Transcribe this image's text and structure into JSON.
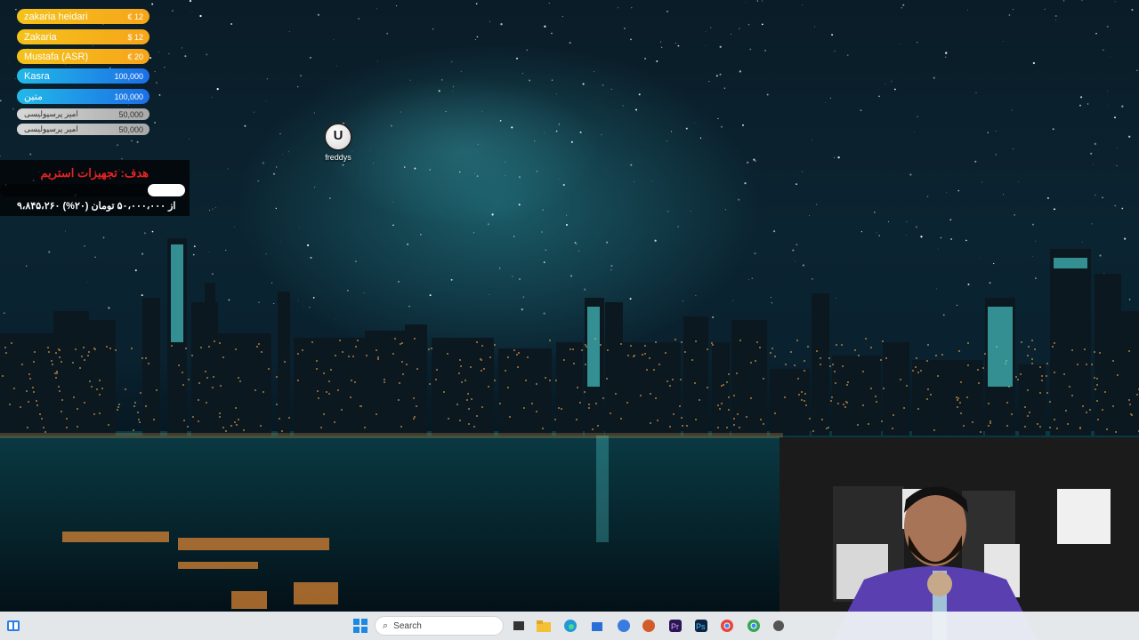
{
  "donations": [
    {
      "name": "zakaria heidari",
      "amount": "€ 12",
      "style": "gold"
    },
    {
      "name": "Zakaria",
      "amount": "$ 12",
      "style": "gold"
    },
    {
      "name": "Mustafa (ASR)",
      "amount": "€ 20",
      "style": "gold"
    },
    {
      "name": "Kasra",
      "amount": "100,000",
      "style": "blue"
    },
    {
      "name": "متین",
      "amount": "100,000",
      "style": "blue"
    },
    {
      "name": "امیر پرسپولیسی",
      "amount": "50,000",
      "style": "gray"
    },
    {
      "name": "امیر پرسپولیسی",
      "amount": "50,000",
      "style": "gray"
    }
  ],
  "goal": {
    "title": "هدف: تجهیزات استریم",
    "progress_text": "۹،۸۴۵،۲۶۰ از ۵۰،۰۰۰،۰۰۰ تومان (۲۰%)",
    "progress_fraction": 0.2,
    "title_color": "#e42323"
  },
  "desktop_icons": [
    {
      "label": "freddys",
      "icon": "unreal-engine-icon"
    }
  ],
  "taskbar": {
    "search_placeholder": "Search",
    "pinned": [
      "start-icon",
      "file-explorer-icon",
      "edge-icon",
      "store-icon",
      "browser-icon",
      "vpn-icon",
      "premiere-icon",
      "photoshop-icon",
      "chrome-icon",
      "chrome-profile-icon",
      "settings-icon"
    ]
  },
  "colors": {
    "gold": "#f4c21a",
    "blue": "#1c6fe6",
    "gray": "#bdbdbd"
  }
}
